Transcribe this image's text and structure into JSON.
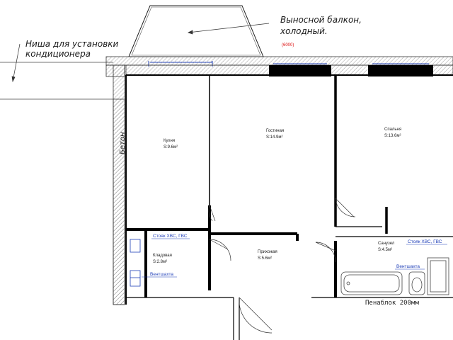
{
  "annotations": {
    "balcony_line1": "Выносной балкон,",
    "balcony_line2": "холодный.",
    "balcony_dim": "(6000)",
    "niche_line1": "Ниша для установки",
    "niche_line2": "кондиционера",
    "wall_material": "Бетон",
    "foam_block": "Пенаблок 200мм"
  },
  "rooms": {
    "kitchen": {
      "name": "Кухня",
      "area": "S:9.6м²"
    },
    "living": {
      "name": "Гостиная",
      "area": "S:14.9м²"
    },
    "bedroom": {
      "name": "Спальня",
      "area": "S:13.6м²"
    },
    "storage": {
      "name": "Кладовая",
      "area": "S:2.8м²"
    },
    "hallway": {
      "name": "Прихожая",
      "area": "S:5.6м²"
    },
    "bathroom": {
      "name": "Санузел",
      "area": "S:4.5м²"
    }
  },
  "risers": {
    "left": "Стояк ХВС, ГВС",
    "right": "Стояк ХВС, ГВС"
  },
  "vents": {
    "left": "Вентшахта",
    "right": "Вентшахта"
  },
  "colors": {
    "wall": "#000000",
    "blue": "#1f3fb8",
    "red": "#dd1111",
    "hatch": "#777777"
  }
}
